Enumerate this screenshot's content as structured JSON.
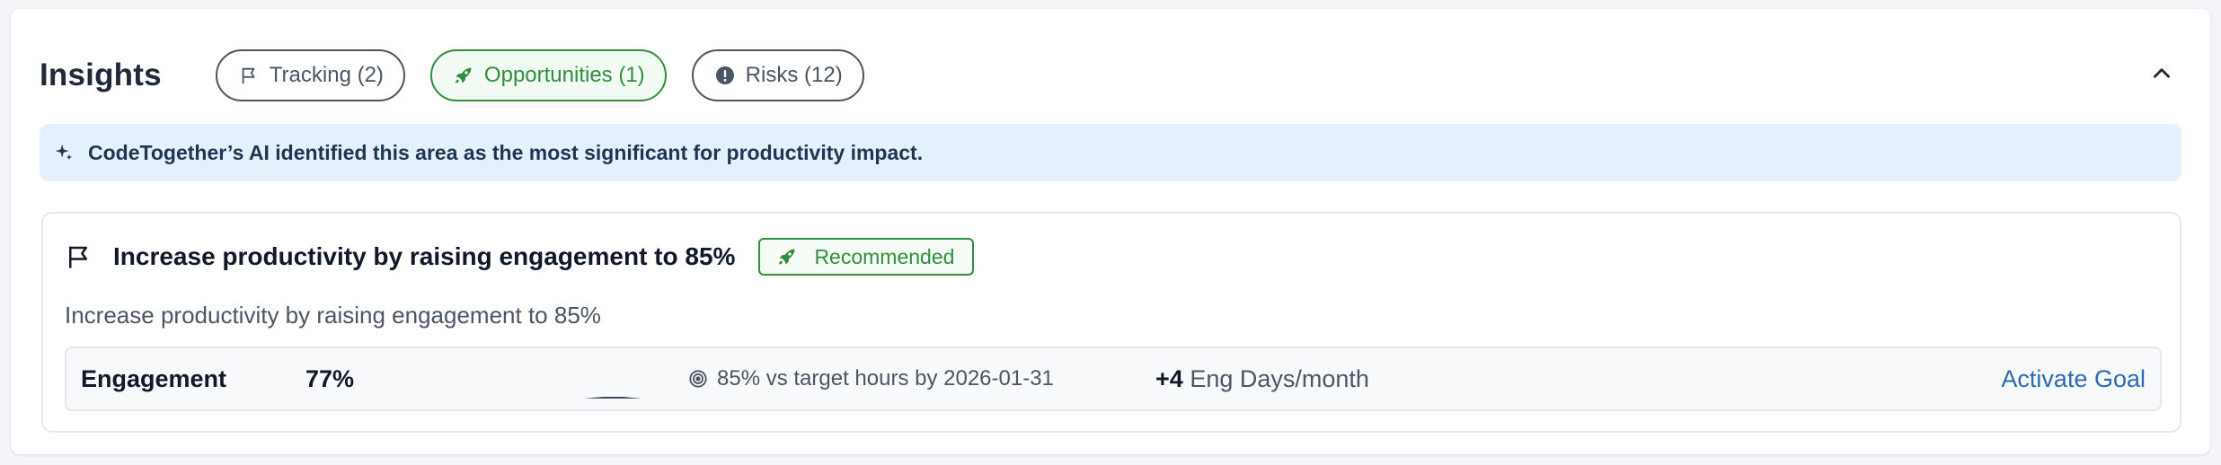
{
  "insights": {
    "title": "Insights",
    "filters": [
      {
        "label": "Tracking (2)",
        "icon": "flag-icon",
        "active": false
      },
      {
        "label": "Opportunities (1)",
        "icon": "rocket-icon",
        "active": true
      },
      {
        "label": "Risks (12)",
        "icon": "exclamation-circle-icon",
        "active": false
      }
    ],
    "collapse_icon": "chevron-up-icon"
  },
  "banner": {
    "icon": "sparkles-icon",
    "text": "CodeTogether’s AI identified this area as the most significant for productivity impact."
  },
  "goal": {
    "icon": "flag-icon",
    "title": "Increase productivity by raising engagement to 85%",
    "badge": "Recommended",
    "badge_icon": "rocket-icon",
    "subtitle": "Increase productivity by raising engagement to 85%",
    "metric": {
      "label": "Engagement",
      "value": "77%",
      "sparkline": [
        0.76,
        0.77,
        0.77,
        0.76,
        0.77,
        0.77,
        0.76,
        0.77,
        0.77,
        0.77,
        0.78,
        0.78,
        0.77
      ],
      "target_icon": "target-icon",
      "target": "85% vs target hours by 2026-01-31",
      "gain_value": "+4",
      "gain_unit": "Eng Days/month",
      "action": "Activate Goal"
    }
  },
  "colors": {
    "accent_green": "#2f8f3a",
    "link_blue": "#2b6cb0",
    "banner_bg": "#e4f0fb"
  }
}
